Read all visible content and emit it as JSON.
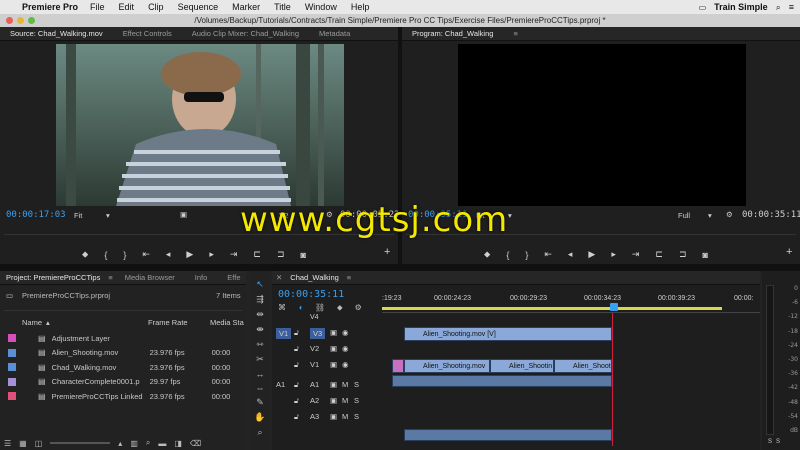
{
  "menubar": {
    "app_name": "Premiere Pro",
    "menus": [
      "File",
      "Edit",
      "Clip",
      "Sequence",
      "Marker",
      "Title",
      "Window",
      "Help"
    ],
    "right_label": "Train Simple"
  },
  "window": {
    "title": "/Volumes/Backup/Tutorials/Contracts/Train Simple/Premiere Pro CC Tips/Exercise Files/PremiereProCCTips.prproj *"
  },
  "source": {
    "tabs": [
      "Source: Chad_Walking.mov",
      "Effect Controls",
      "Audio Clip Mixer: Chad_Walking",
      "Metadata"
    ],
    "timecode": "00:00:17:03",
    "fit": "Fit",
    "resolution": "1/2",
    "duration": "00:00:05:22"
  },
  "program": {
    "tab": "Program: Chad_Walking",
    "timecode": "00:00:35:11",
    "fit": "Fit",
    "resolution": "Full",
    "duration": "00:00:35:11"
  },
  "project": {
    "tabs": [
      "Project: PremiereProCCTips",
      "Media Browser",
      "Info",
      "Effe"
    ],
    "file": "PremiereProCCTips.prproj",
    "item_count": "7 Items",
    "columns": [
      "Name",
      "Frame Rate",
      "Media Sta"
    ],
    "items": [
      {
        "name": "Adjustment Layer",
        "rate": "",
        "start": "",
        "color": "#d64fb8"
      },
      {
        "name": "Alien_Shooting.mov",
        "rate": "23.976 fps",
        "start": "00:00",
        "color": "#5a8fd6"
      },
      {
        "name": "Chad_Walking.mov",
        "rate": "23.976 fps",
        "start": "00:00",
        "color": "#5a8fd6"
      },
      {
        "name": "CharacterComplete0001.p",
        "rate": "29.97 fps",
        "start": "00:00",
        "color": "#a58fd6"
      },
      {
        "name": "PremiereProCCTips Linked",
        "rate": "23.976 fps",
        "start": "00:00",
        "color": "#e0507a"
      }
    ]
  },
  "timeline": {
    "tab": "Chad_Walking",
    "timecode": "00:00:35:11",
    "ruler": [
      ":19:23",
      "00:00:24:23",
      "00:00:29:23",
      "00:00:34:23",
      "00:00:39:23",
      "00:00:"
    ],
    "tracks": [
      {
        "id": "V4",
        "target": "",
        "label": "V4"
      },
      {
        "id": "V3",
        "target": "V1",
        "label": "V3"
      },
      {
        "id": "V2",
        "target": "",
        "label": "V2"
      },
      {
        "id": "V1",
        "target": "",
        "label": "V1"
      },
      {
        "id": "A1",
        "target": "A1",
        "label": "A1"
      },
      {
        "id": "A2",
        "target": "",
        "label": "A2"
      },
      {
        "id": "A3",
        "target": "",
        "label": "A3"
      }
    ],
    "clips_v3": [
      "Alien_Shooting.mov [V]"
    ],
    "clips_v1": [
      "Alien_Shooting.mov",
      "Alien_Shootin",
      "Alien_Shoot"
    ]
  },
  "meter": {
    "ticks": [
      "0",
      "-6",
      "-12",
      "-18",
      "-24",
      "-30",
      "-36",
      "-42",
      "-48",
      "-54",
      "dB"
    ],
    "solo": [
      "S",
      "S"
    ]
  },
  "watermark": "www.cgtsj.com"
}
